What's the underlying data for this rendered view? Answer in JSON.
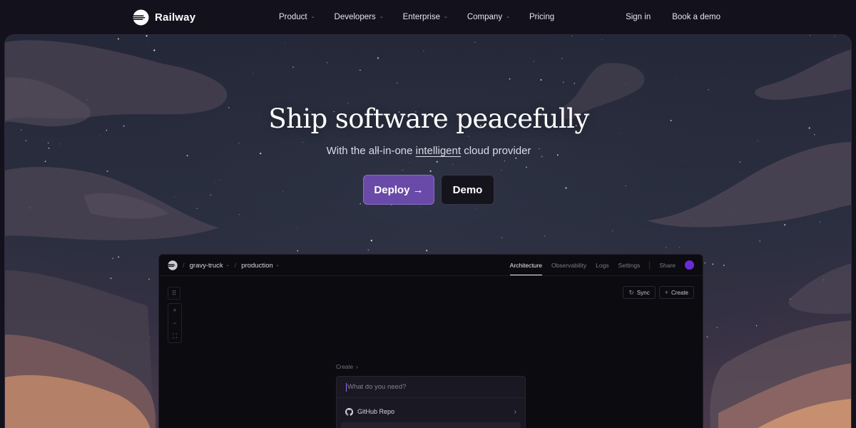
{
  "nav": {
    "brand": "Railway",
    "menu": [
      {
        "label": "Product",
        "has_dropdown": true
      },
      {
        "label": "Developers",
        "has_dropdown": true
      },
      {
        "label": "Enterprise",
        "has_dropdown": true
      },
      {
        "label": "Company",
        "has_dropdown": true
      },
      {
        "label": "Pricing",
        "has_dropdown": false
      }
    ],
    "sign_in": "Sign in",
    "book_demo": "Book a demo",
    "chevron": "⌄",
    "icons": {
      "logo": "railway-logo-icon",
      "dropdown": "chevron-down-icon"
    }
  },
  "hero": {
    "title": "Ship software peacefully",
    "subtitle_before": "With the all-in-one ",
    "subtitle_link": "intelligent",
    "subtitle_after": " cloud provider",
    "primary_button": "Deploy →",
    "secondary_button": "Demo"
  },
  "app": {
    "project": "gravy-truck",
    "environment": "production",
    "tabs": [
      "Architecture",
      "Observability",
      "Logs",
      "Settings"
    ],
    "active_tab": "Architecture",
    "share": "Share",
    "sync_label": "Sync",
    "create_label": "Create",
    "tools": {
      "grid": "⠿",
      "zoom_in": "+",
      "zoom_out": "−",
      "fit": "⛶"
    },
    "sync_icon": "↻",
    "create_icon": "+",
    "command": {
      "breadcrumb": "Create",
      "breadcrumb_sep": "›",
      "placeholder": "What do you need?",
      "items": [
        {
          "label": "GitHub Repo",
          "icon": "github-icon"
        }
      ],
      "item_arrow": "›"
    },
    "accent": "#6c2bd9"
  },
  "colors": {
    "background": "#13111c",
    "primary_button": "#6a4aa8",
    "secondary_button": "#15131c"
  }
}
